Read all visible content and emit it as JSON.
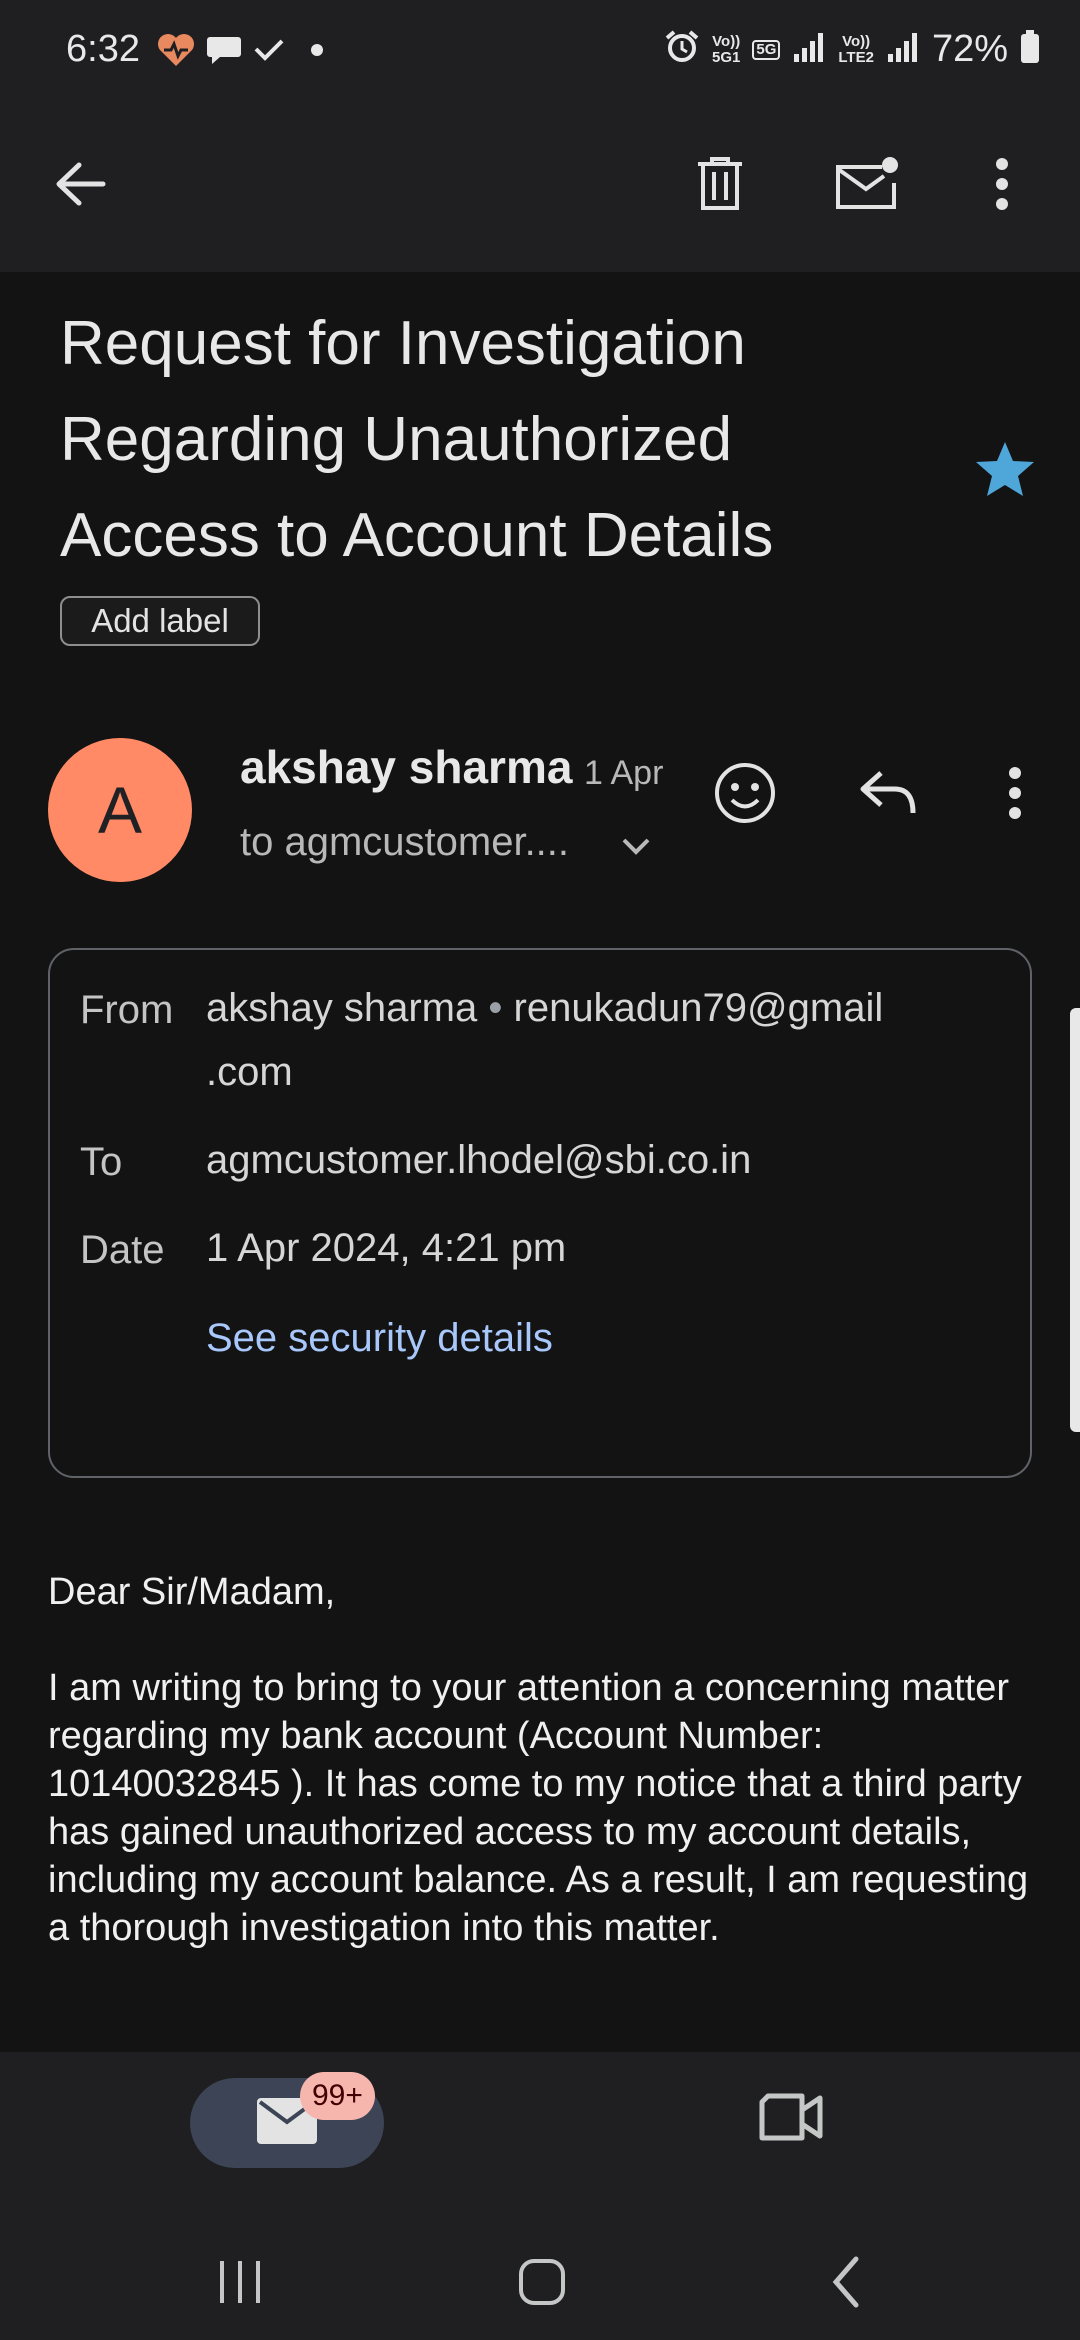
{
  "status_bar": {
    "time": "6:32",
    "battery_percent": "72%",
    "sim1_label_top": "Vo))",
    "sim1_label_bottom": "5G1",
    "network_type": "5G",
    "sim2_label_top": "Vo))",
    "sim2_label_bottom": "LTE2",
    "left_icons": [
      "heart-rate-icon",
      "chat-bubble-icon",
      "check-icon",
      "dot-icon"
    ],
    "right_icons": [
      "alarm-icon",
      "signal-icon",
      "signal-icon",
      "battery-icon"
    ]
  },
  "app_bar": {
    "icons": [
      "back-arrow-icon",
      "delete-icon",
      "mark-unread-icon",
      "more-vert-icon"
    ]
  },
  "email": {
    "subject": "Request for Investigation Regarding Unauthorized Access to Account Details",
    "starred": true,
    "add_label": "Add label",
    "sender_initial": "A",
    "sender_name": "akshay sharma",
    "date_short": "1 Apr",
    "recipient_short": "to agmcustomer....",
    "details": {
      "from_label": "From",
      "from_name": "akshay sharma",
      "from_separator": "•",
      "from_email_line1": "renukadun79@gmail",
      "from_email_line2": ".com",
      "to_label": "To",
      "to_value": "agmcustomer.lhodel@sbi.co.in",
      "date_label": "Date",
      "date_value": "1 Apr 2024, 4:21 pm",
      "security_link": "See security details"
    },
    "body": [
      "Dear Sir/Madam,",
      "I am writing to bring to your attention a concerning matter regarding my bank account (Account Number: 10140032845 ). It has come to my notice that a third party has gained unauthorized access to my account details, including my account balance. As a result, I am requesting a thorough investigation into this matter."
    ]
  },
  "bottom_nav": {
    "mail_badge": "99+",
    "tabs": [
      "mail-icon",
      "video-camera-icon"
    ]
  },
  "colors": {
    "background": "#131314",
    "bar_background": "#1f1f21",
    "avatar": "#ff8a65",
    "star": "#4fa6d8",
    "link": "#a8c7fa",
    "badge": "#f7b6ad",
    "pill": "#3c4456"
  }
}
